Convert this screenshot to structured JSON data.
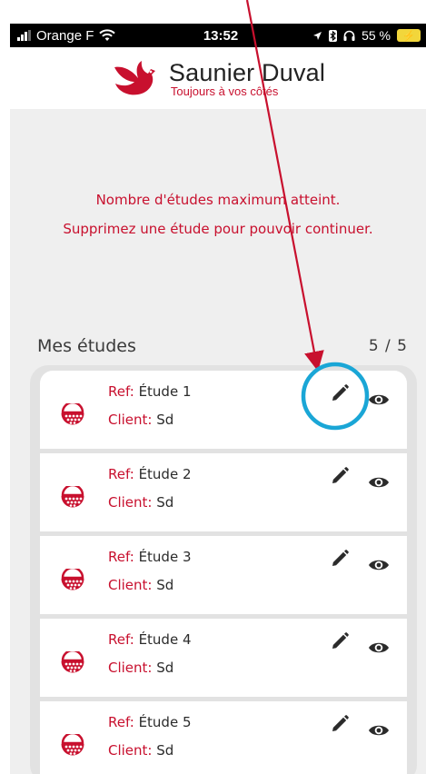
{
  "status_bar": {
    "carrier": "Orange F",
    "time": "13:52",
    "battery_percent": "55 %"
  },
  "header": {
    "brand_name": "Saunier Duval",
    "tagline": "Toujours à vos côtés"
  },
  "warning": {
    "line1": "Nombre d'études maximum atteint.",
    "line2": "Supprimez une étude pour pouvoir continuer."
  },
  "studies": {
    "title": "Mes études",
    "count": "5 / 5",
    "ref_label": "Ref:",
    "client_label": "Client:",
    "items": [
      {
        "ref": "Étude 1",
        "client": "Sd"
      },
      {
        "ref": "Étude 2",
        "client": "Sd"
      },
      {
        "ref": "Étude 3",
        "client": "Sd"
      },
      {
        "ref": "Étude 4",
        "client": "Sd"
      },
      {
        "ref": "Étude 5",
        "client": "Sd"
      }
    ]
  },
  "colors": {
    "brand_red": "#c8102e",
    "background": "#efefef",
    "annotation_circle": "#1aa6d6"
  }
}
